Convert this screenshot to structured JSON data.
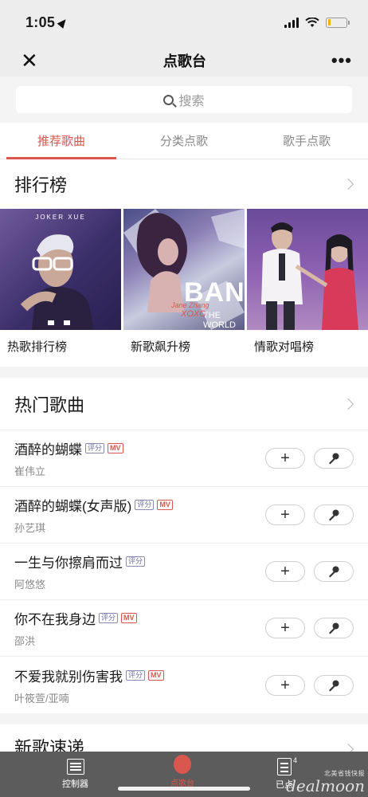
{
  "status_bar": {
    "time": "1:05",
    "battery_level": 0.18
  },
  "nav": {
    "title": "点歌台"
  },
  "search": {
    "placeholder": "搜索"
  },
  "tabs": [
    {
      "label": "推荐歌曲",
      "active": true
    },
    {
      "label": "分类点歌",
      "active": false
    },
    {
      "label": "歌手点歌",
      "active": false
    }
  ],
  "charts_section": {
    "title": "排行榜",
    "items": [
      {
        "label": "热歌排行榜",
        "cover_text": "JOKER XUE"
      },
      {
        "label": "新歌飙升榜",
        "cover_text": "BAN",
        "cover_text_2": "Jane Zhang",
        "cover_text_3": "XOXO",
        "cover_text_4": "THE WORLD"
      },
      {
        "label": "情歌对唱榜"
      }
    ]
  },
  "hot_section": {
    "title": "热门歌曲",
    "songs": [
      {
        "title": "酒醉的蝴蝶",
        "artist": "崔伟立",
        "tags": [
          "评分",
          "MV"
        ]
      },
      {
        "title": "酒醉的蝴蝶(女声版)",
        "artist": "孙艺琪",
        "tags": [
          "评分",
          "MV"
        ]
      },
      {
        "title": "一生与你擦肩而过",
        "artist": "阿悠悠",
        "tags": [
          "评分"
        ]
      },
      {
        "title": "你不在我身边",
        "artist": "邵洪",
        "tags": [
          "评分",
          "MV"
        ]
      },
      {
        "title": "不爱我就别伤害我",
        "artist": "叶筱萱/亚喃",
        "tags": [
          "评分",
          "MV"
        ]
      }
    ]
  },
  "new_section": {
    "title": "新歌速递"
  },
  "bottom_bar": {
    "controller_label": "控制器",
    "center_label": "点歌台",
    "queue_label": "已点",
    "queue_count": "4"
  },
  "watermark": {
    "line1": "北美省钱快报",
    "brand": "dealmoon"
  },
  "colors": {
    "accent": "#d9574e",
    "bottom_bar": "#5c5c5c"
  }
}
